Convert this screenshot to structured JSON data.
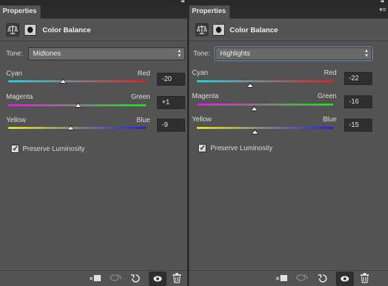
{
  "panels": [
    {
      "tab_title": "Properties",
      "adjustment_title": "Color Balance",
      "tone": {
        "label": "Tone:",
        "value": "Midtones"
      },
      "sliders": [
        {
          "left": "Cyan",
          "right": "Red",
          "value": "-20",
          "level": -20
        },
        {
          "left": "Magenta",
          "right": "Green",
          "value": "+1",
          "level": 1
        },
        {
          "left": "Yellow",
          "right": "Blue",
          "value": "-9",
          "level": -9
        }
      ],
      "preserve_luminosity": {
        "label": "Preserve Luminosity",
        "checked": true
      }
    },
    {
      "tab_title": "Properties",
      "adjustment_title": "Color Balance",
      "tone": {
        "label": "Tone:",
        "value": "Highlights"
      },
      "sliders": [
        {
          "left": "Cyan",
          "right": "Red",
          "value": "-22",
          "level": -22
        },
        {
          "left": "Magenta",
          "right": "Green",
          "value": "-16",
          "level": -16
        },
        {
          "left": "Yellow",
          "right": "Blue",
          "value": "-15",
          "level": -15
        }
      ],
      "preserve_luminosity": {
        "label": "Preserve Luminosity",
        "checked": true
      }
    }
  ],
  "slider_range": [
    -100,
    100
  ],
  "colors": {
    "cyan_red": [
      "#22d6e6",
      "#e02020"
    ],
    "magenta_green": [
      "#e020e0",
      "#20e020"
    ],
    "yellow_blue": [
      "#e8e820",
      "#2020e0"
    ]
  },
  "footer_icons": [
    "clip-to-layer-icon",
    "view-previous-state-icon",
    "reset-icon",
    "visibility-eye-icon",
    "trash-icon"
  ]
}
